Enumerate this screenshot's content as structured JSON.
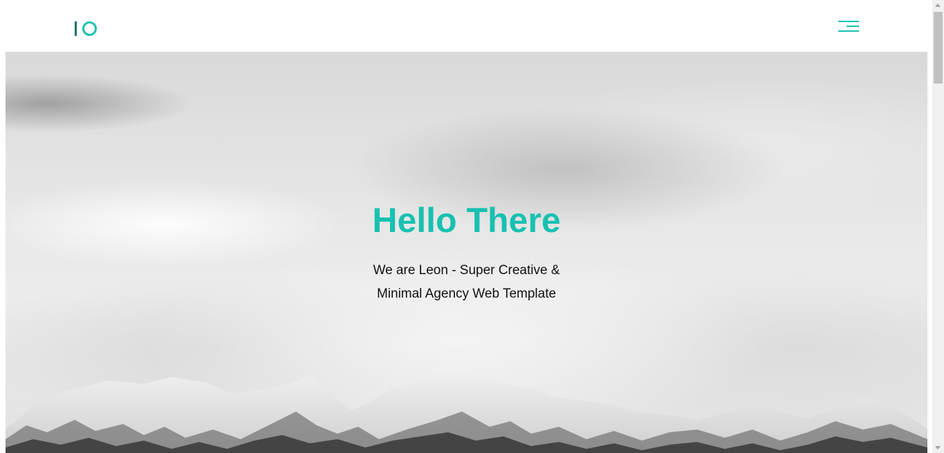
{
  "header": {
    "logo": {
      "icon": "io-logo-icon",
      "bar_color": "#1a6f6a",
      "ring_color": "#17c1b1"
    },
    "menu_icon": "hamburger-menu-icon"
  },
  "hero": {
    "title": "Hello There",
    "subtitle": "We are Leon - Super Creative & Minimal Agency Web Template",
    "background_image": "snowy-mountains-under-cloudy-sky"
  },
  "colors": {
    "accent": "#17c1b1",
    "text": "#111111",
    "page_background": "#ffffff"
  }
}
